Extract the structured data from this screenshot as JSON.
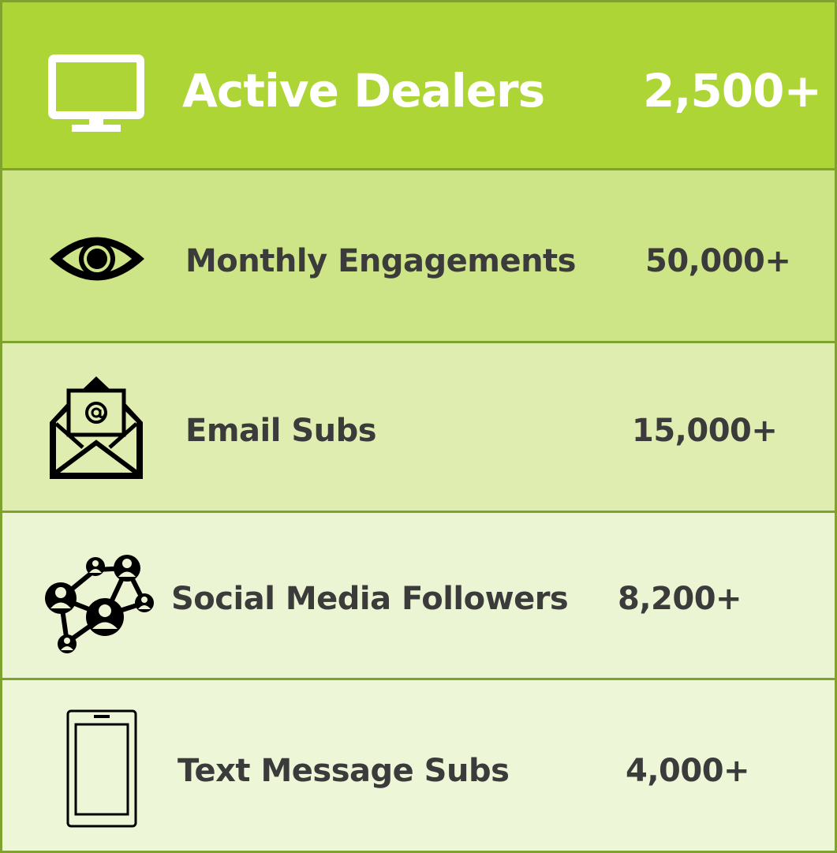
{
  "colors": {
    "border": "#7fa12e",
    "row_active_dealers": "#add535",
    "row_monthly_engagements": "#cde487",
    "row_email_subs": "#dfeeb0",
    "row_social_media_followers": "#ebf5d3",
    "row_text_message_subs": "#eef6d8",
    "header_text": "#ffffff",
    "body_text": "#3b3b3b"
  },
  "stats": [
    {
      "icon": "monitor-icon",
      "label": "Active Dealers",
      "value": "2,500+"
    },
    {
      "icon": "eye-icon",
      "label": "Monthly Engagements",
      "value": "50,000+"
    },
    {
      "icon": "email-envelope-icon",
      "label": "Email Subs",
      "value": "15,000+"
    },
    {
      "icon": "social-network-icon",
      "label": "Social Media Followers",
      "value": "8,200+"
    },
    {
      "icon": "mobile-phone-icon",
      "label": "Text Message Subs",
      "value": "4,000+"
    }
  ]
}
